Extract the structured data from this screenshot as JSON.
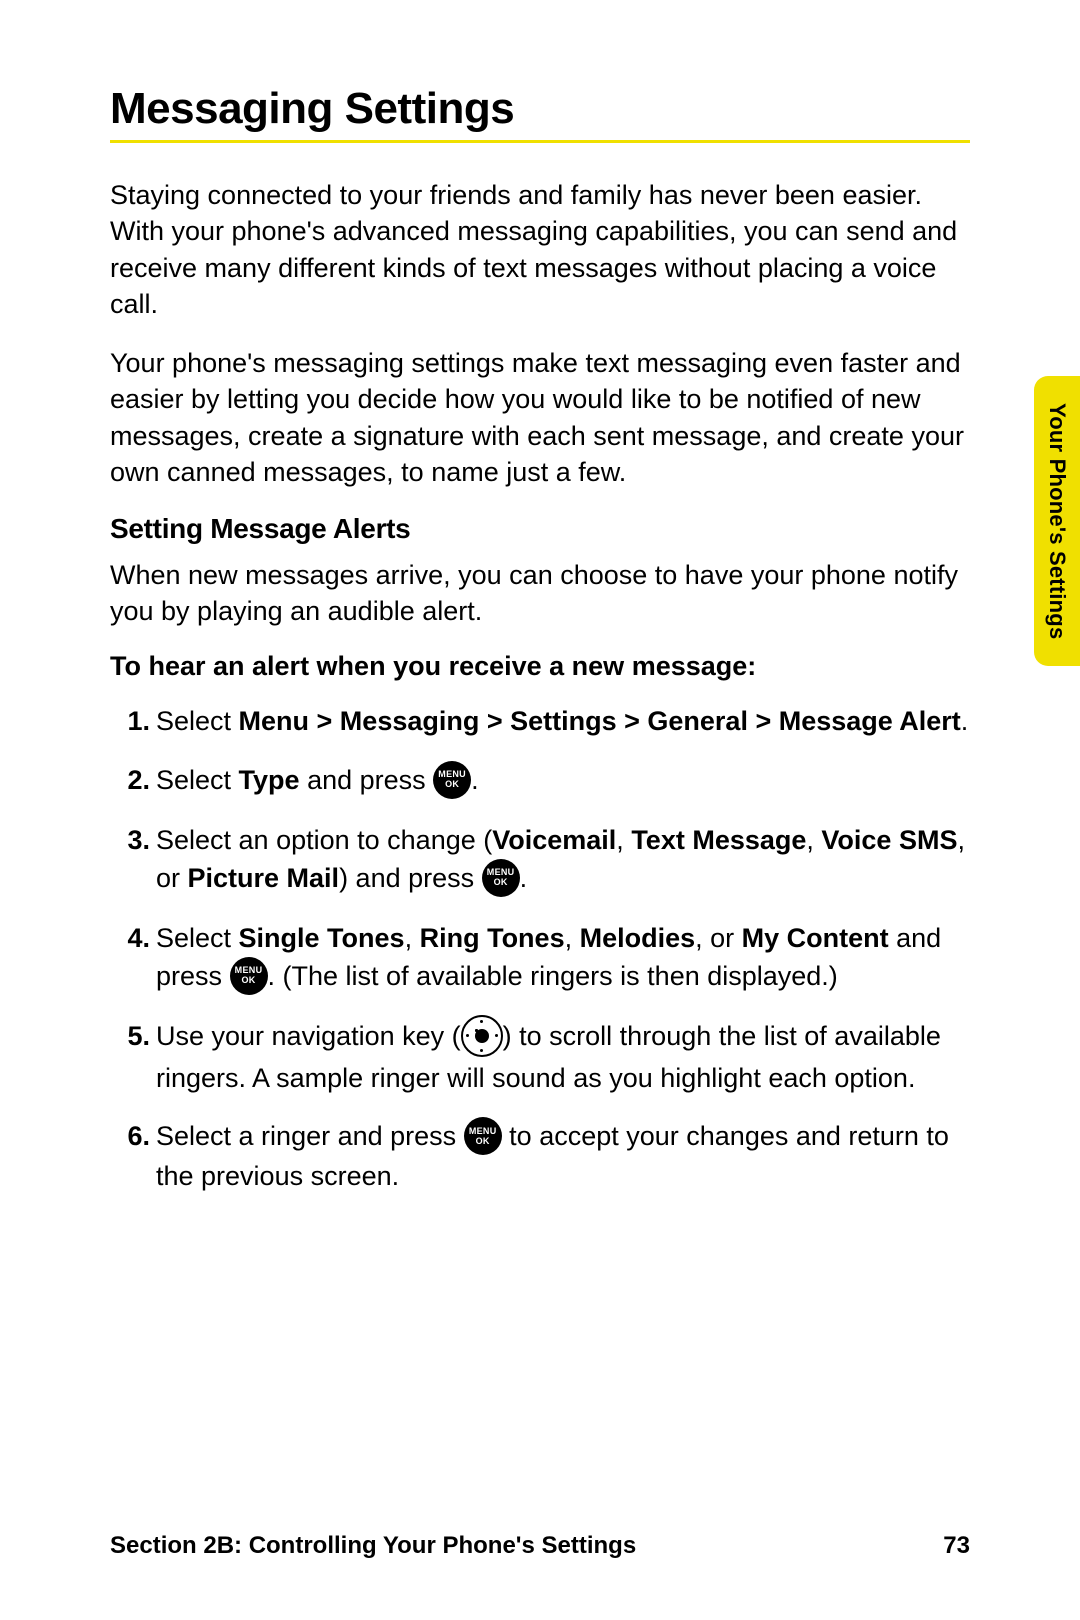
{
  "title": "Messaging Settings",
  "intro1": "Staying connected to your friends and family has never been easier. With your phone's advanced messaging capabilities, you can send and receive many different kinds of text messages without placing a voice call.",
  "intro2": "Your phone's messaging settings make text messaging even faster and easier by letting you decide how you would like to be notified of new messages, create a signature with each sent message, and create your own canned messages, to name just a few.",
  "subhead": "Setting Message Alerts",
  "subpara": "When new messages arrive, you can choose to have your phone notify you by playing an audible alert.",
  "lead": "To hear an alert when you receive a new message:",
  "steps": {
    "s1_pre": "Select ",
    "s1_bold": "Menu > Messaging > Settings > General > Message Alert",
    "s1_post": ".",
    "s2_pre": "Select ",
    "s2_bold": "Type",
    "s2_mid": " and press ",
    "s2_post": ".",
    "s3_pre": "Select an option to change (",
    "s3_b1": "Voicemail",
    "s3_c1": ", ",
    "s3_b2": "Text Message",
    "s3_c2": ", ",
    "s3_b3": "Voice SMS",
    "s3_c3": ", or ",
    "s3_b4": "Picture Mail",
    "s3_mid": ") and press ",
    "s3_post": ".",
    "s4_pre": "Select ",
    "s4_b1": "Single Tones",
    "s4_c1": ", ",
    "s4_b2": "Ring Tones",
    "s4_c2": ", ",
    "s4_b3": "Melodies",
    "s4_c3": ", or ",
    "s4_b4": "My Content",
    "s4_mid": " and press ",
    "s4_post": ". (The list of available ringers is then displayed.)",
    "s5_pre": "Use your navigation key (",
    "s5_post": ") to scroll through the list of available ringers. A sample ringer will sound as you highlight each option.",
    "s6_pre": "Select a ringer and press ",
    "s6_post": " to accept your changes and return to the previous screen."
  },
  "button": {
    "l1": "MENU",
    "l2": "OK"
  },
  "sideTab": "Your Phone's Settings",
  "footerLeft": "Section 2B: Controlling Your Phone's Settings",
  "footerRight": "73"
}
